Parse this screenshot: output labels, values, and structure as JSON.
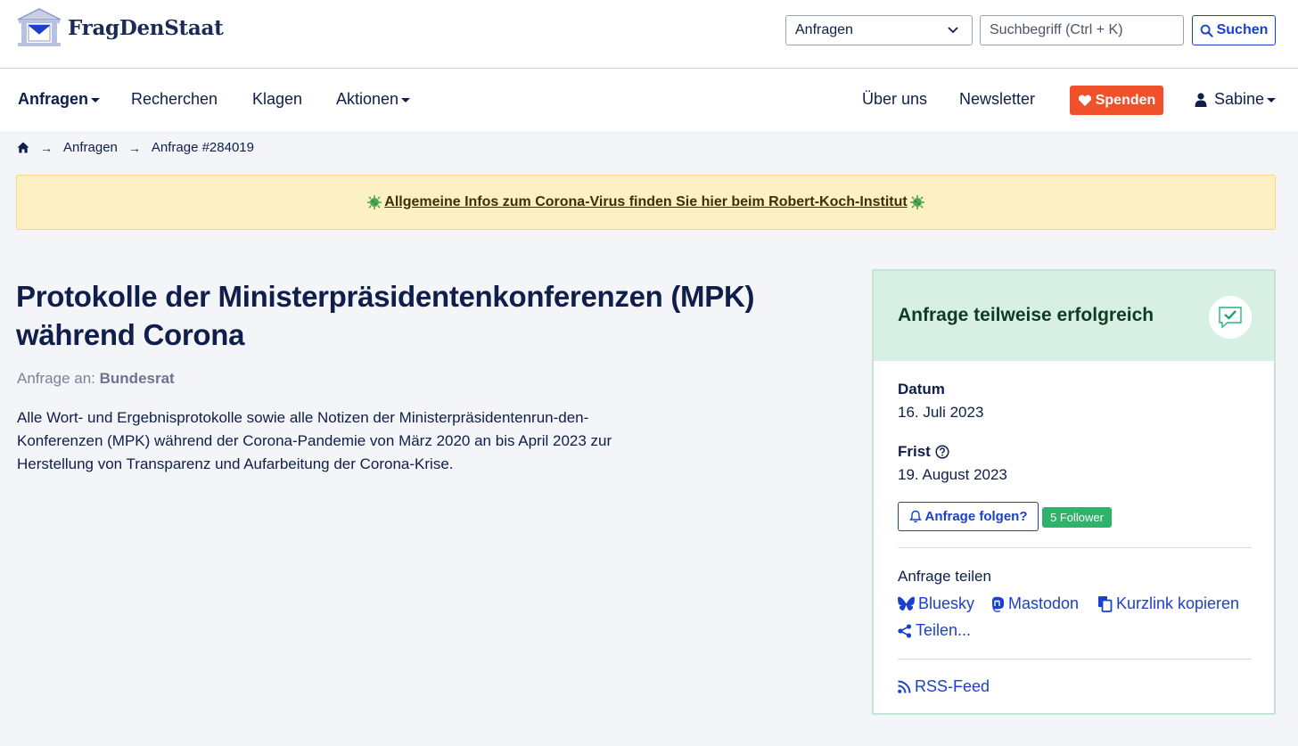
{
  "header": {
    "brand": "FragDenStaat",
    "search_scope": "Anfragen",
    "search_placeholder": "Suchbegriff (Ctrl + K)",
    "search_button": "Suchen"
  },
  "nav": {
    "anfragen": "Anfragen",
    "recherchen": "Recherchen",
    "klagen": "Klagen",
    "aktionen": "Aktionen",
    "ueber_uns": "Über uns",
    "newsletter": "Newsletter",
    "spenden": "Spenden",
    "user": "Sabine"
  },
  "breadcrumb": {
    "anfragen": "Anfragen",
    "current": "Anfrage #284019"
  },
  "banner": {
    "text": "Allgemeine Infos zum Corona-Virus finden Sie hier beim Robert-Koch-Institut"
  },
  "request": {
    "title": "Protokolle der Ministerpräsidentenkonferenzen (MPK) während Corona",
    "recipient_label": "Anfrage an:",
    "recipient": "Bundesrat",
    "description": "Alle Wort- und Ergebnisprotokolle sowie alle Notizen der Ministerpräsidentenrun-den-Konferenzen (MPK) während der Corona-Pandemie von März 2020 an bis April 2023 zur Herstellung von Transparenz und Aufarbeitung der Corona-Krise."
  },
  "sidebar": {
    "status": "Anfrage teilweise erfolgreich",
    "datum_label": "Datum",
    "datum": "16. Juli 2023",
    "frist_label": "Frist",
    "frist": "19. August 2023",
    "follow_button": "Anfrage folgen?",
    "followers": "5 Follower",
    "share_title": "Anfrage teilen",
    "share_bluesky": "Bluesky",
    "share_mastodon": "Mastodon",
    "share_shortlink": "Kurzlink kopieren",
    "share_more": "Teilen...",
    "rss": "RSS-Feed"
  },
  "colors": {
    "primary": "#1a3fd1",
    "navy": "#0f1e4a",
    "donate": "#f0502a",
    "success_bg": "#d8f0e3",
    "banner_bg": "#fdf0c4",
    "badge": "#2fb36a"
  }
}
